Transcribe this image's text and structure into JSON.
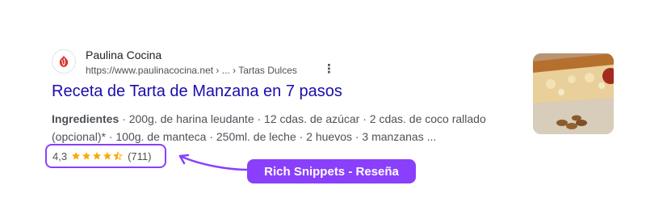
{
  "result": {
    "site_name": "Paulina Cocina",
    "site_url": "https://www.paulinacocina.net › ... › Tartas Dulces",
    "title": "Receta de Tarta de Manzana en 7 pasos",
    "snippet_label": "Ingredientes",
    "snippet_text": " · 200g. de harina leudante · 12 cdas. de azúcar · 2 cdas. de coco rallado (opcional)* · 100g. de manteca · 250ml. de leche · 2 huevos · 3 manzanas ...",
    "rating_value": "4,3",
    "rating_count": "(711)",
    "stars": 4.3,
    "favicon_icon": "paulina-cocina-logo-icon",
    "thumbnail_icon": "apple-tart-photo"
  },
  "annotation": {
    "callout_label": "Rich Snippets - Reseña",
    "accent_color": "#8a3ffc"
  },
  "colors": {
    "title_link": "#1a0dab",
    "star": "#f9ab00",
    "text": "#4d5156"
  }
}
